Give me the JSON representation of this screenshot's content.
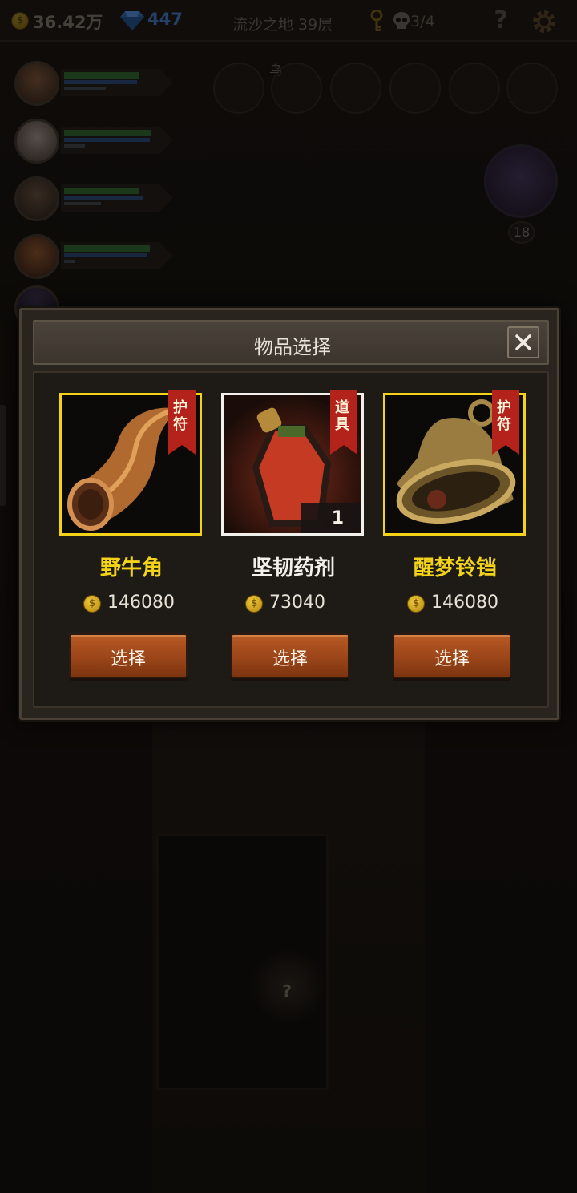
{
  "topbar": {
    "gold": "36.42万",
    "gems": "447",
    "floor": "流沙之地 39层",
    "skulls": "3/4",
    "help": "?"
  },
  "scene": {
    "slot_caption": "鸟",
    "boss_level": "18",
    "corridor_mark": "?"
  },
  "heroes": [
    {
      "hp": 0.72,
      "mp": 0.7,
      "xp": 0.4
    },
    {
      "hp": 0.83,
      "mp": 0.82,
      "xp": 0.2
    },
    {
      "hp": 0.72,
      "mp": 0.75,
      "xp": 0.35
    },
    {
      "hp": 0.82,
      "mp": 0.8,
      "xp": 0.1
    }
  ],
  "modal": {
    "title": "物品选择",
    "items": [
      {
        "name": "野牛角",
        "tag": "护符",
        "price": "146080",
        "button": "选择",
        "name_color": "#f2d319",
        "icon": "bison-horn-icon"
      },
      {
        "name": "坚韧药剂",
        "tag": "道具",
        "price": "73040",
        "button": "选择",
        "count": "1",
        "name_color": "#f2f0ea",
        "icon": "potion-icon"
      },
      {
        "name": "醒梦铃铛",
        "tag": "护符",
        "price": "146080",
        "button": "选择",
        "name_color": "#f2d319",
        "icon": "bell-icon"
      }
    ]
  },
  "colors": {
    "rare_border": "#f2d319",
    "common_border": "#f2f0ea",
    "tag_red": "#b3231c",
    "button_orange": "#a64c1c"
  }
}
